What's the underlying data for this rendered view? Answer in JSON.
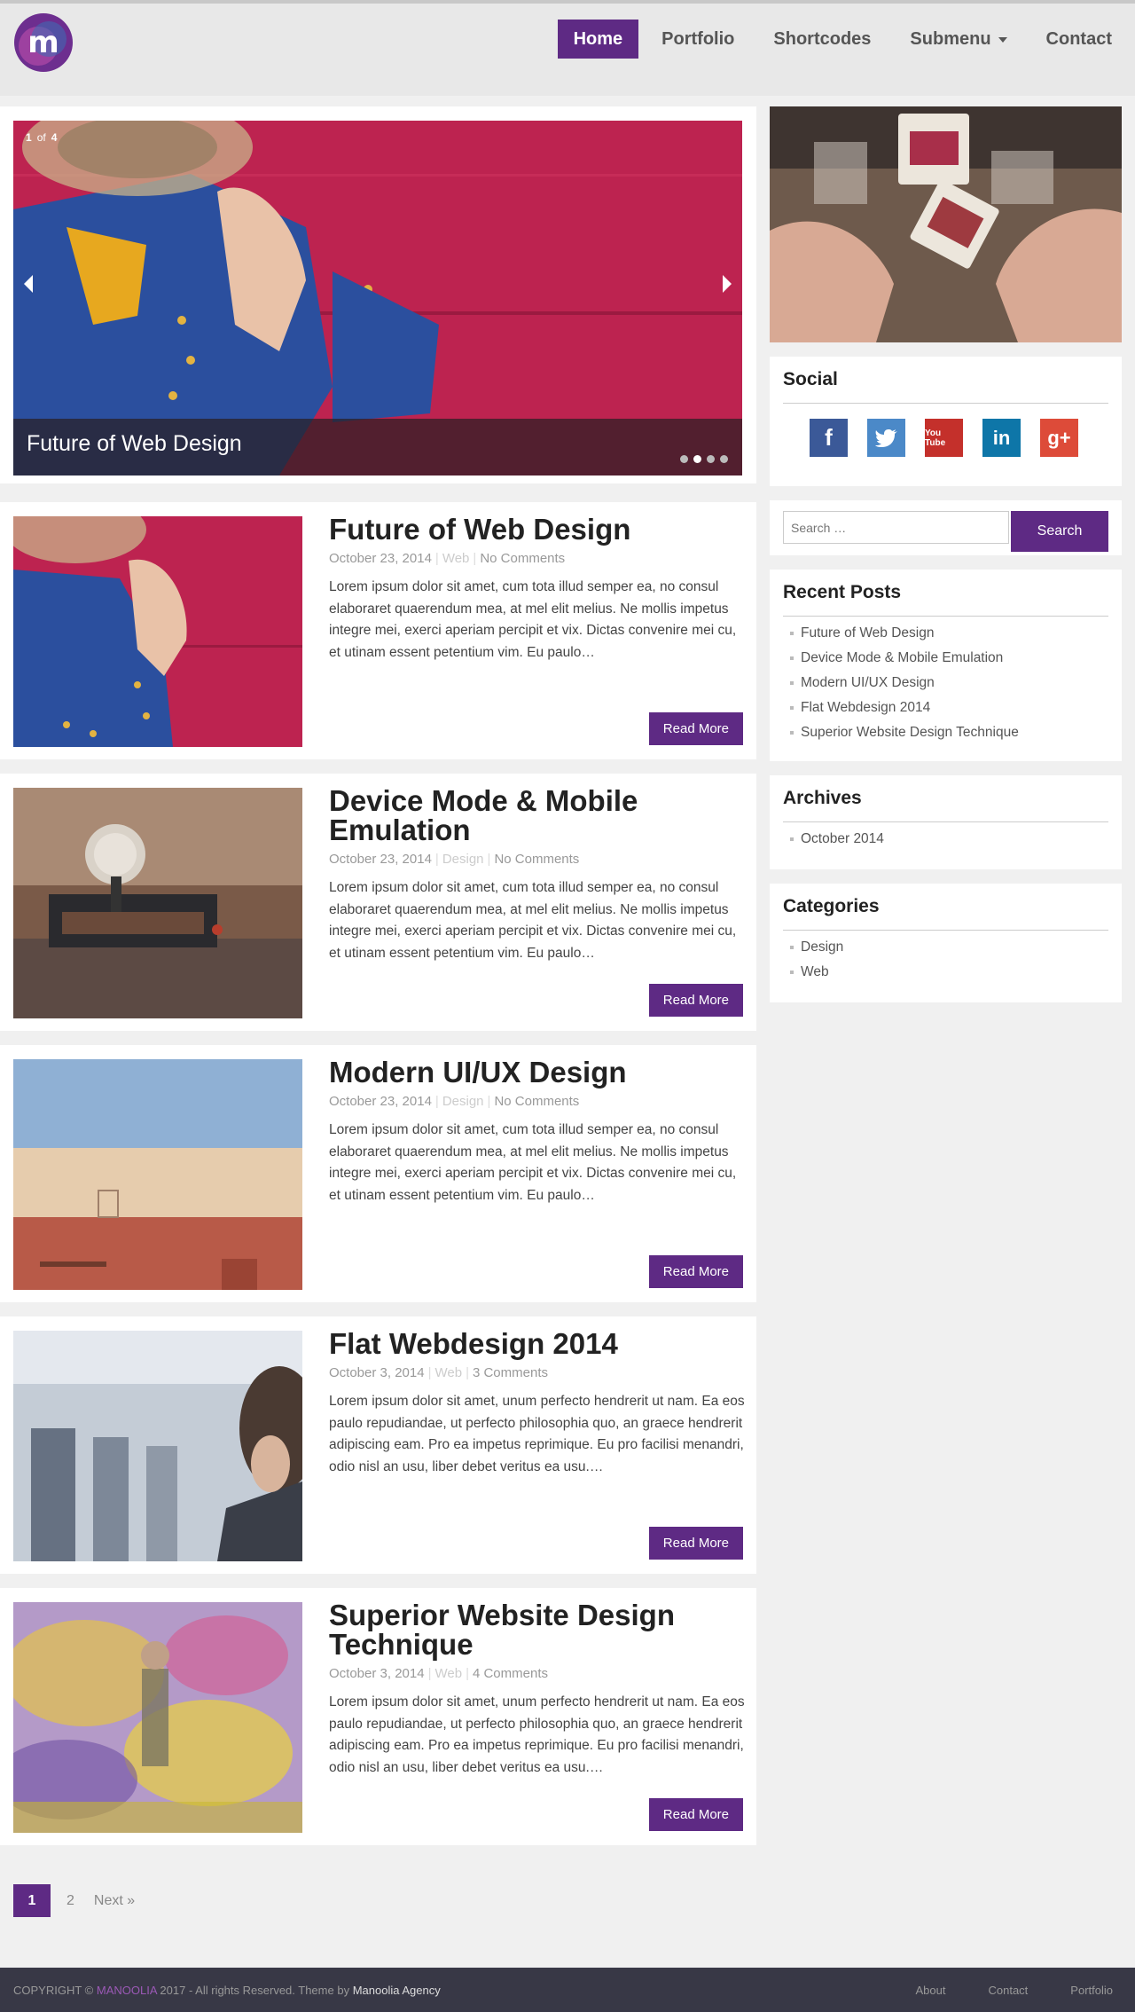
{
  "header": {
    "logo_text": "m",
    "nav": [
      {
        "label": "Home",
        "active": true
      },
      {
        "label": "Portfolio"
      },
      {
        "label": "Shortcodes"
      },
      {
        "label": "Submenu",
        "dropdown": true
      },
      {
        "label": "Contact"
      }
    ]
  },
  "slider": {
    "current": "1",
    "of": "of",
    "total": "4",
    "caption": "Future of Web Design",
    "dots": 4,
    "active_dot": 1
  },
  "posts": [
    {
      "title": "Future of Web Design",
      "date": "October 23, 2014",
      "category": "Web",
      "comments": "No Comments",
      "excerpt": "Lorem ipsum dolor sit amet, cum tota illud semper ea, no consul elaboraret quaerendum mea, at mel elit melius. Ne mollis impetus integre mei, exerci aperiam percipit et vix. Dictas convenire mei cu, et utinam essent petentium vim. Eu paulo…",
      "read_more": "Read More"
    },
    {
      "title": "Device Mode & Mobile Emulation",
      "date": "October 23, 2014",
      "category": "Design",
      "comments": "No Comments",
      "excerpt": "Lorem ipsum dolor sit amet, cum tota illud semper ea, no consul elaboraret quaerendum mea, at mel elit melius. Ne mollis impetus integre mei, exerci aperiam percipit et vix. Dictas convenire mei cu, et utinam essent petentium vim. Eu paulo…",
      "read_more": "Read More"
    },
    {
      "title": "Modern UI/UX Design",
      "date": "October 23, 2014",
      "category": "Design",
      "comments": "No Comments",
      "excerpt": "Lorem ipsum dolor sit amet, cum tota illud semper ea, no consul elaboraret quaerendum mea, at mel elit melius. Ne mollis impetus integre mei, exerci aperiam percipit et vix. Dictas convenire mei cu, et utinam essent petentium vim. Eu paulo…",
      "read_more": "Read More"
    },
    {
      "title": "Flat Webdesign 2014",
      "date": "October 3, 2014",
      "category": "Web",
      "comments": "3 Comments",
      "excerpt": "Lorem ipsum dolor sit amet, unum perfecto hendrerit ut nam. Ea eos paulo repudiandae, ut perfecto philosophia quo, an graece hendrerit adipiscing eam. Pro ea impetus reprimique. Eu pro facilisi menandri, odio nisl an usu, liber debet veritus ea usu.…",
      "read_more": "Read More"
    },
    {
      "title": "Superior Website Design Technique",
      "date": "October 3, 2014",
      "category": "Web",
      "comments": "4 Comments",
      "excerpt": "Lorem ipsum dolor sit amet, unum perfecto hendrerit ut nam. Ea eos paulo repudiandae, ut perfecto philosophia quo, an graece hendrerit adipiscing eam. Pro ea impetus reprimique. Eu pro facilisi menandri, odio nisl an usu, liber debet veritus ea usu.…",
      "read_more": "Read More"
    }
  ],
  "sidebar": {
    "social": {
      "title": "Social",
      "icons": [
        {
          "name": "facebook-icon",
          "glyph": "f",
          "color": "#3b5998"
        },
        {
          "name": "twitter-icon",
          "glyph": "t",
          "color": "#4b89c8"
        },
        {
          "name": "youtube-icon",
          "glyph": "You Tube",
          "color": "#c4302b"
        },
        {
          "name": "linkedin-icon",
          "glyph": "in",
          "color": "#0e76a8"
        },
        {
          "name": "googleplus-icon",
          "glyph": "g+",
          "color": "#dd4b39"
        }
      ]
    },
    "search": {
      "placeholder": "Search …",
      "button": "Search"
    },
    "recent_posts": {
      "title": "Recent Posts",
      "items": [
        "Future of Web Design",
        "Device Mode & Mobile Emulation",
        "Modern UI/UX Design",
        "Flat Webdesign 2014",
        "Superior Website Design Technique"
      ]
    },
    "archives": {
      "title": "Archives",
      "items": [
        "October 2014"
      ]
    },
    "categories": {
      "title": "Categories",
      "items": [
        "Design",
        "Web"
      ]
    }
  },
  "pagination": {
    "current": "1",
    "page2": "2",
    "next": "Next »"
  },
  "footer": {
    "copyright_prefix": "COPYRIGHT ©",
    "brand": "MANOOLIA",
    "copyright_suffix": "2017 - All rights Reserved. Theme by",
    "agency": "Manoolia Agency",
    "links": [
      "About",
      "Contact",
      "Portfolio"
    ]
  },
  "colors": {
    "accent": "#5e2a84",
    "footer": "#383846"
  }
}
